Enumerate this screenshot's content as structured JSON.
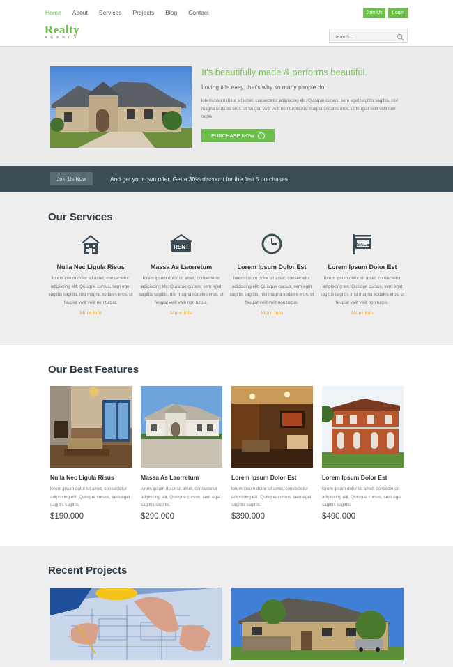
{
  "header": {
    "nav": [
      {
        "label": "Home",
        "active": true
      },
      {
        "label": "About"
      },
      {
        "label": "Services"
      },
      {
        "label": "Projects"
      },
      {
        "label": "Blog"
      },
      {
        "label": "Contact"
      }
    ],
    "logo": {
      "main": "Realty",
      "sub": "AGENCY"
    },
    "join_label": "Join Us",
    "login_label": "Login",
    "search_placeholder": "search..."
  },
  "hero": {
    "title": "It's beautifully made & performs beautiful.",
    "subtitle": "Loving it is easy, that's why so many people do.",
    "text": "lorem ipsum dolor sit amet, consectetur adipiscing elit. Quisque cursus, sem eget sagittis sagittis, nisl magna sodales eros. ut feugiat velit velit non turpis.nisl magna sodales eros. ut feugiat velit velit non turpis",
    "button_label": "PURCHASE NOW"
  },
  "offer": {
    "button_label": "Join Us Now",
    "text": "And get your own offer. Get a 30% discount for the first 5 purchases."
  },
  "services": {
    "title": "Our Services",
    "items": [
      {
        "icon": "house-icon",
        "title": "Nulla Nec Ligula Risus",
        "text": "lorem ipsum dolor sit amet, consectetur adipiscing elit. Quisque cursus, sem eget sagittis sagittis, nisl magna sodales eros. ut feugiat velit velit non turpis.",
        "more": "More Info"
      },
      {
        "icon": "rent-sign-icon",
        "icon_text": "RENT",
        "title": "Massa As Laorretum",
        "text": "lorem ipsum dolor sit amet, consectetur adipiscing elit. Quisque cursus, sem eget sagittis sagittis, nisl magna sodales eros. ut feugiat velit velit non turpis.",
        "more": "More Info"
      },
      {
        "icon": "clock-icon",
        "title": "Lorem Ipsum Dolor Est",
        "text": "lorem ipsum dolor sit amet, consectetur adipiscing elit. Quisque cursus, sem eget sagittis sagittis, nisl magna sodales eros. ut feugiat velit velit non turpis.",
        "more": "More Info"
      },
      {
        "icon": "sale-sign-icon",
        "icon_text": "SALE",
        "title": "Lorem Ipsum Dolor Est",
        "text": "lorem ipsum dolor sit amet, consectetur adipiscing elit. Quisque cursus, sem eget sagittis sagittis, nisl magna sodales eros. ut feugiat velit velit non turpis.",
        "more": "More Info"
      }
    ]
  },
  "features": {
    "title": "Our Best Features",
    "items": [
      {
        "title": "Nulla Nec Ligula Risus",
        "text": "lorem ipsum dolor sit amet, consectetur adipiscing elit. Quisque cursus, sem eget sagittis sagittis.",
        "price": "$190.000"
      },
      {
        "title": "Massa As Laorretum",
        "text": "lorem ipsum dolor sit amet, consectetur adipiscing elit. Quisque cursus, sem eget sagittis sagittis.",
        "price": "$290.000"
      },
      {
        "title": "Lorem Ipsum Dolor Est",
        "text": "lorem ipsum dolor sit amet, consectetur adipiscing elit. Quisque cursus, sem eget sagittis sagittis.",
        "price": "$390.000"
      },
      {
        "title": "Lorem Ipsum Dolor Est",
        "text": "lorem ipsum dolor sit amet, consectetur adipiscing elit. Quisque cursus, sem eget sagittis sagittis.",
        "price": "$490.000"
      }
    ]
  },
  "recent": {
    "title": "Recent Projects"
  },
  "colors": {
    "accent": "#6cc04a",
    "dark_bar": "#3c4d55",
    "link_orange": "#e4a84a"
  }
}
